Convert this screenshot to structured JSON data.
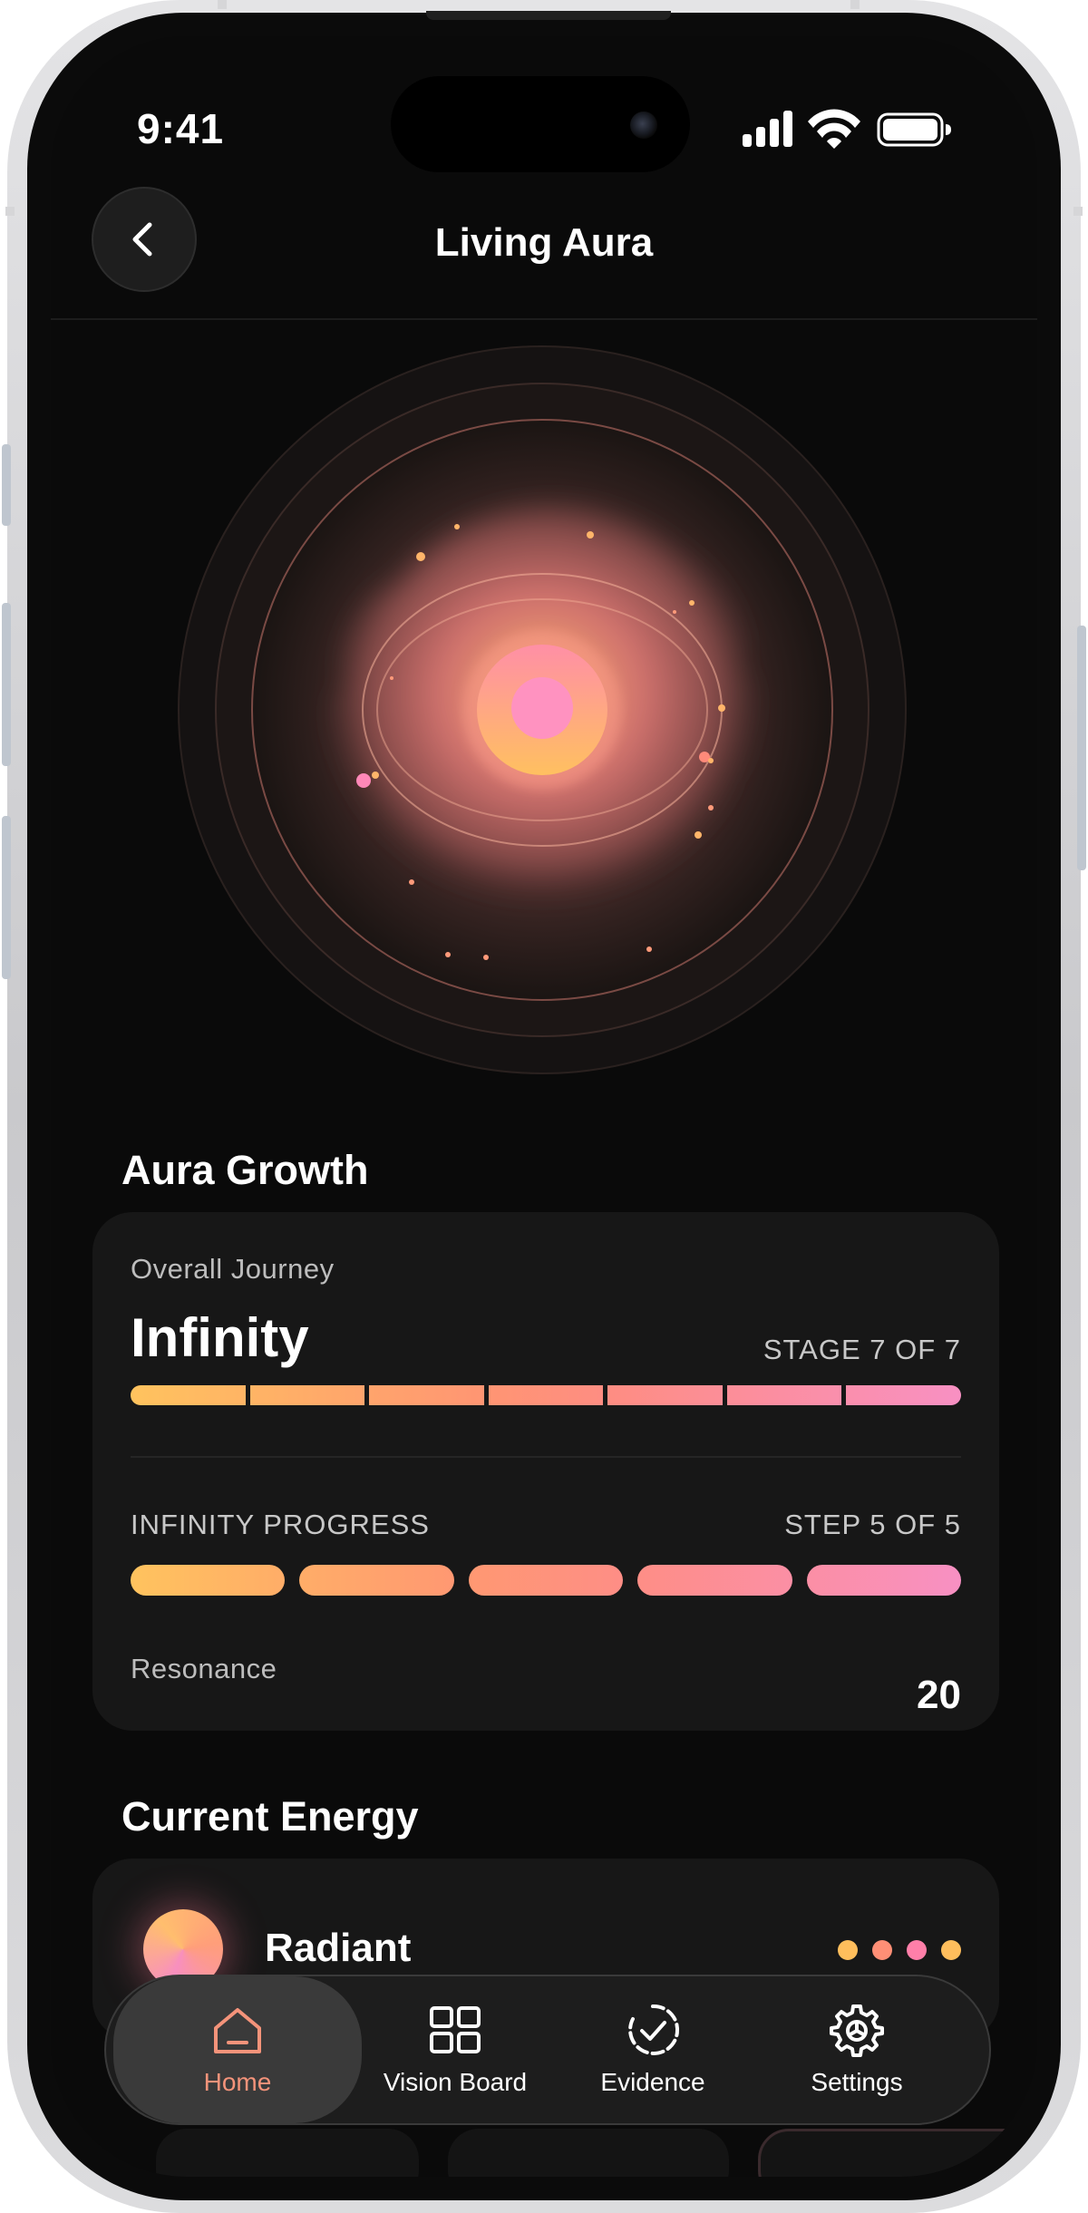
{
  "status_bar": {
    "time": "9:41"
  },
  "header": {
    "title": "Living Aura"
  },
  "aura_growth": {
    "section_title": "Aura Growth",
    "overall_label": "Overall Journey",
    "stage_name": "Infinity",
    "stage_text": "STAGE 7 OF 7",
    "stage_progress": 1.0,
    "progress_label": "INFINITY PROGRESS",
    "step_text": "STEP 5 OF 5",
    "step_progress": 1.0,
    "resonance_label": "Resonance",
    "resonance_value": "20"
  },
  "current_energy": {
    "section_title": "Current Energy",
    "name": "Radiant",
    "dot_colors": [
      "#ffbe5c",
      "#ff8f76",
      "#ff7fa9",
      "#ffbe5c"
    ]
  },
  "tab_bar": {
    "tabs": [
      {
        "label": "Home",
        "icon": "home-icon",
        "active": true
      },
      {
        "label": "Vision Board",
        "icon": "grid-icon",
        "active": false
      },
      {
        "label": "Evidence",
        "icon": "check-circle-icon",
        "active": false
      },
      {
        "label": "Settings",
        "icon": "gear-icon",
        "active": false
      }
    ]
  },
  "colors": {
    "accent_start": "#ffc35e",
    "accent_mid": "#ff8d77",
    "accent_end": "#f890c3",
    "active_tab": "#f4937a"
  }
}
